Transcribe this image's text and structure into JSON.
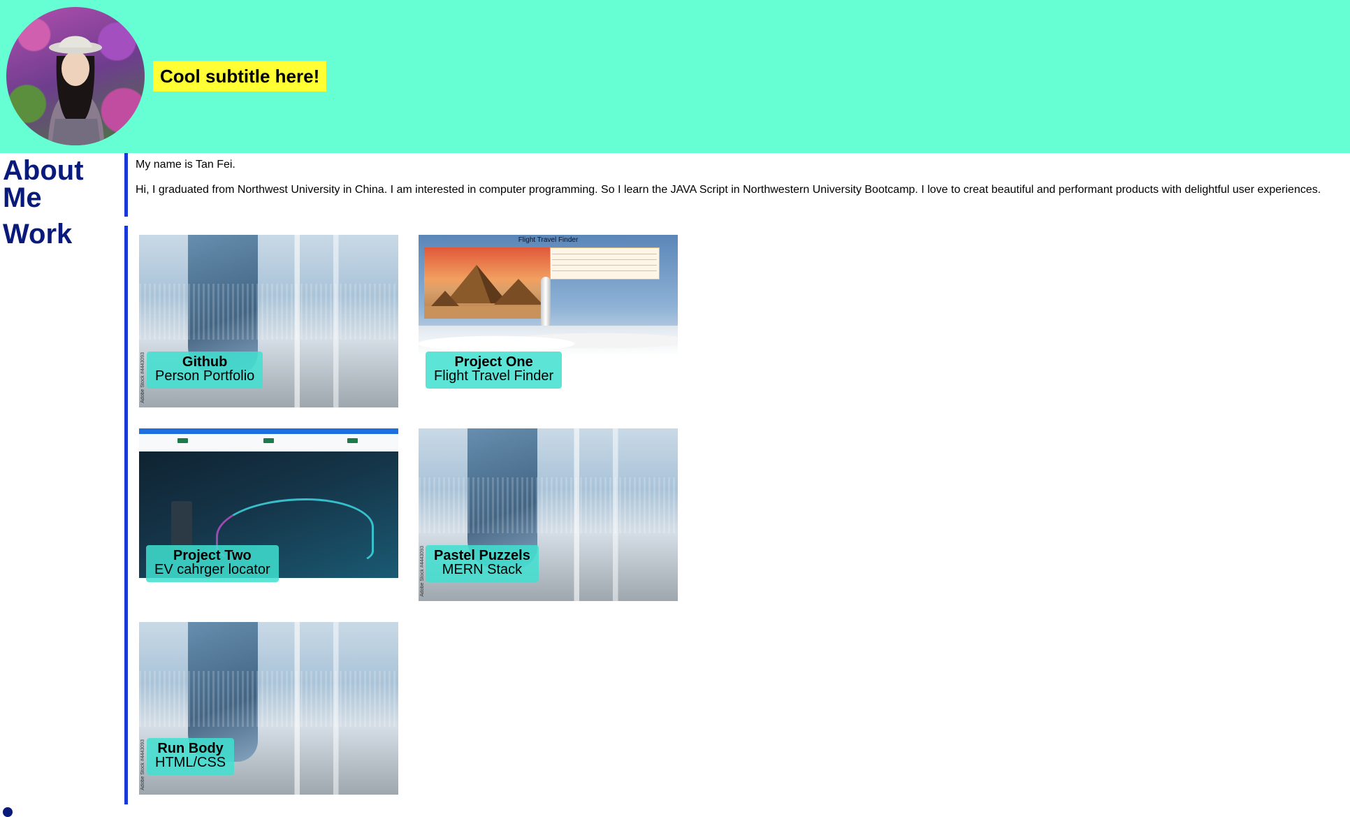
{
  "header": {
    "subtitle": "Cool subtitle here!",
    "background": "#66ffd4",
    "avatar_alt": "profile photo"
  },
  "about": {
    "heading": "About Me",
    "paragraphs": [
      "My name is Tan Fei.",
      "Hi, I graduated from Northwest University in China. I am interested in computer programming. So I learn the JAVA Script in Northwestern University Bootcamp. I love to creat beautiful and performant products with delightful user experiences."
    ]
  },
  "work": {
    "heading": "Work",
    "projects": [
      {
        "title": "Github",
        "subtitle": "Person Portfolio",
        "thumb": "generic",
        "thumb_text": "Adobe Stock #4443093"
      },
      {
        "title": "Project One",
        "subtitle": "Flight Travel Finder",
        "thumb": "flight",
        "thumb_title": "Flight Travel Finder"
      },
      {
        "title": "Project Two",
        "subtitle": "EV cahrger locator",
        "thumb": "ev"
      },
      {
        "title": "Pastel Puzzels",
        "subtitle": "MERN Stack",
        "thumb": "generic",
        "thumb_text": "Adobe Stock #4443093"
      },
      {
        "title": "Run Body",
        "subtitle": "HTML/CSS",
        "thumb": "generic",
        "thumb_text": "Adobe Stock #4443093"
      }
    ]
  },
  "colors": {
    "accent_bar": "#1a38d8",
    "heading": "#0a1a7a",
    "caption_bg": "#40e0d0",
    "subtitle_bg": "#ffff33"
  }
}
